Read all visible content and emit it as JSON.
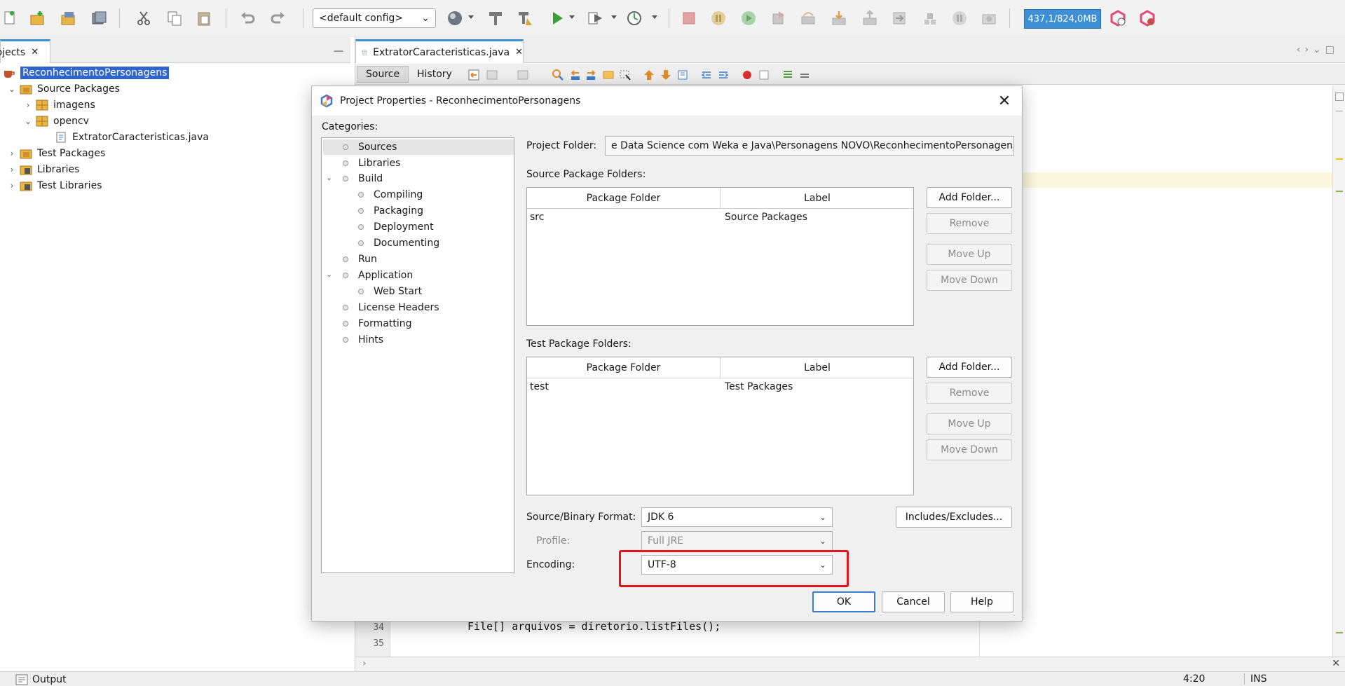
{
  "toolbar": {
    "config": "<default config>",
    "memory": "437,1/824,0MB",
    "icons": [
      "new-file-icon",
      "new-project-icon",
      "open-project-icon",
      "save-all-icon",
      "cut-icon",
      "copy-icon",
      "paste-icon",
      "undo-icon",
      "redo-icon",
      "globe-icon",
      "build-icon",
      "clean-build-icon",
      "run-icon",
      "debug-icon",
      "profile-icon",
      "stop-icon",
      "pause-icon",
      "continue-icon",
      "step-icon",
      "step-over-icon",
      "step-into-icon",
      "step-out-icon",
      "run-to-cursor-icon",
      "apply-changes-icon",
      "snapshot-icon",
      "gc-icon",
      "profiler-icon"
    ]
  },
  "projects": {
    "tab_label": "Projects",
    "tree": [
      {
        "label": "ReconhecimentoPersonagens",
        "icon": "coffee-cup-icon"
      },
      {
        "label": "Source Packages",
        "icon": "package-folder-icon"
      },
      {
        "label": "imagens",
        "icon": "package-icon"
      },
      {
        "label": "opencv",
        "icon": "package-icon"
      },
      {
        "label": "ExtratorCaracteristicas.java",
        "icon": "java-file-icon"
      },
      {
        "label": "Test Packages",
        "icon": "package-folder-icon"
      },
      {
        "label": "Libraries",
        "icon": "library-icon"
      },
      {
        "label": "Test Libraries",
        "icon": "library-icon"
      }
    ]
  },
  "editor": {
    "tab_label": "ExtratorCaracteristicas.java",
    "source_tab": "Source",
    "history_tab": "History",
    "line_34_num": "34",
    "line_35_num": "35",
    "line_34_code": "File[] arquivos = diretorio.listFiles();"
  },
  "status": {
    "output_label": "Output",
    "caret_position": "4:20",
    "insert_mode": "INS"
  },
  "dialog": {
    "title": "Project Properties - ReconhecimentoPersonagens",
    "categories_label": "Categories:",
    "categories": [
      {
        "label": "Sources"
      },
      {
        "label": "Libraries"
      },
      {
        "label": "Build"
      },
      {
        "label": "Compiling"
      },
      {
        "label": "Packaging"
      },
      {
        "label": "Deployment"
      },
      {
        "label": "Documenting"
      },
      {
        "label": "Run"
      },
      {
        "label": "Application"
      },
      {
        "label": "Web Start"
      },
      {
        "label": "License Headers"
      },
      {
        "label": "Formatting"
      },
      {
        "label": "Hints"
      }
    ],
    "project_folder_label": "Project Folder:",
    "project_folder_value": "e Data Science com Weka e Java\\Personagens NOVO\\ReconhecimentoPersonagens",
    "source_folders_label": "Source Package Folders:",
    "source_table": {
      "headers": [
        "Package Folder",
        "Label"
      ],
      "rows": [
        [
          "src",
          "Source Packages"
        ]
      ]
    },
    "test_folders_label": "Test Package Folders:",
    "test_table": {
      "headers": [
        "Package Folder",
        "Label"
      ],
      "rows": [
        [
          "test",
          "Test Packages"
        ]
      ]
    },
    "buttons": {
      "add_folder": "Add Folder...",
      "remove": "Remove",
      "move_up": "Move Up",
      "move_down": "Move Down",
      "includes_excludes": "Includes/Excludes...",
      "ok": "OK",
      "cancel": "Cancel",
      "help": "Help"
    },
    "source_binary_label": "Source/Binary Format:",
    "source_binary_value": "JDK 6",
    "profile_label": "Profile:",
    "profile_value": "Full JRE",
    "encoding_label": "Encoding:",
    "encoding_value": "UTF-8",
    "highlight_color": "#e0151b"
  }
}
